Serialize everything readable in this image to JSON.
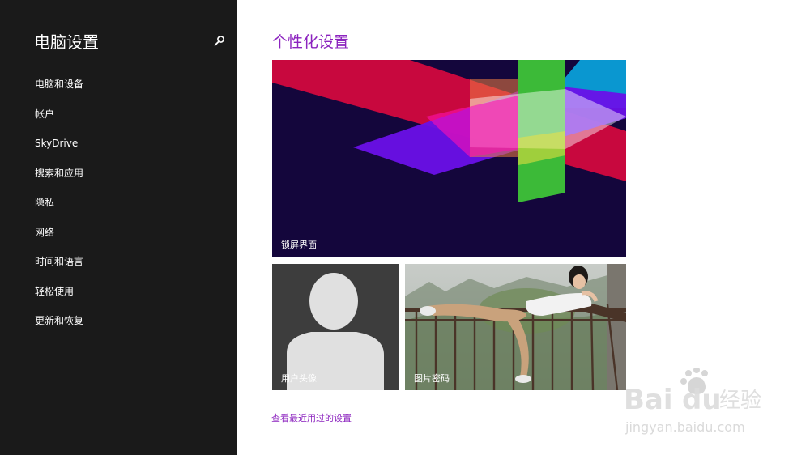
{
  "sidebar": {
    "title": "电脑设置",
    "search_icon": "search-icon",
    "items": [
      {
        "label": "电脑和设备"
      },
      {
        "label": "帐户"
      },
      {
        "label": "SkyDrive"
      },
      {
        "label": "搜索和应用"
      },
      {
        "label": "隐私"
      },
      {
        "label": "网络"
      },
      {
        "label": "时间和语言"
      },
      {
        "label": "轻松使用"
      },
      {
        "label": "更新和恢复"
      }
    ]
  },
  "main": {
    "title": "个性化设置",
    "tiles": {
      "lock_screen": {
        "label": "锁屏界面"
      },
      "account_picture": {
        "label": "用户头像"
      },
      "picture_password": {
        "label": "图片密码"
      }
    },
    "recent_link": "查看最近用过的设置"
  },
  "watermark": {
    "logo_text": "Bai du 经验",
    "url": "jingyan.baidu.com"
  },
  "colors": {
    "sidebar_bg": "#1a1a1a",
    "accent": "#8c24bf",
    "lock_bg": "#14063c"
  }
}
